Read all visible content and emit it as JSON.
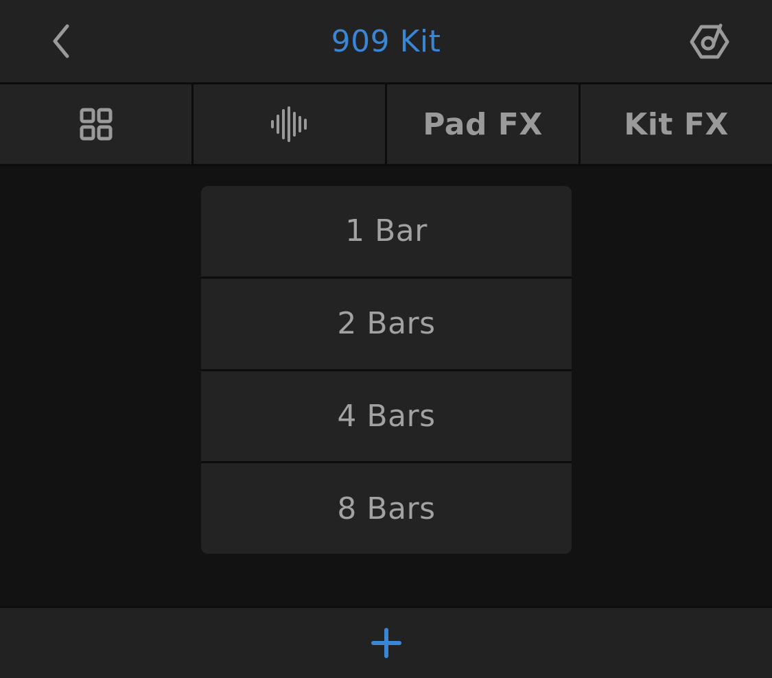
{
  "header": {
    "title": "909 Kit",
    "back_icon": "chevron-left-icon",
    "kit_icon": "drum-kit-icon"
  },
  "tabs": [
    {
      "id": "pads",
      "icon": "grid-icon",
      "label": ""
    },
    {
      "id": "sample",
      "icon": "waveform-icon",
      "label": ""
    },
    {
      "id": "pad-fx",
      "icon": "",
      "label": "Pad FX"
    },
    {
      "id": "kit-fx",
      "icon": "",
      "label": "Kit FX"
    }
  ],
  "options": [
    {
      "label": "1 Bar"
    },
    {
      "label": "2 Bars"
    },
    {
      "label": "4 Bars"
    },
    {
      "label": "8 Bars"
    }
  ],
  "footer": {
    "add_icon": "plus-icon"
  },
  "colors": {
    "accent": "#3a86d4",
    "text": "#9a9a9a",
    "surface": "#232323",
    "background": "#121212"
  }
}
